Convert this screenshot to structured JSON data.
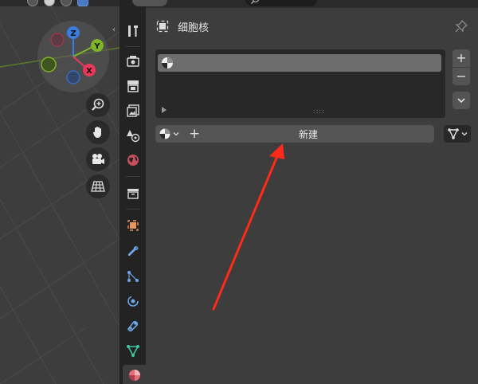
{
  "properties": {
    "breadcrumb_label": "细胞核",
    "new_button_label": "新建",
    "add_symbol": "+",
    "remove_symbol": "−",
    "list_grip": "::::"
  },
  "viewport": {
    "axis_labels": {
      "z": "Z",
      "y": "Y",
      "x": "X"
    }
  },
  "colors": {
    "axis_x": "#e8395a",
    "axis_y": "#7fb524",
    "axis_z": "#3a7de0",
    "annotation_arrow": "#ff2a1a",
    "active_tab_material": "#e66c78"
  },
  "icons": {
    "tabs": [
      "tool-icon",
      "render-icon",
      "output-icon",
      "view-layer-icon",
      "scene-icon",
      "world-icon",
      "collection-icon",
      "object-icon",
      "modifier-icon",
      "particles-icon",
      "physics-icon",
      "constraints-icon",
      "data-icon",
      "material-icon"
    ],
    "viewport_nav": [
      "zoom-icon",
      "hand-icon",
      "camera-icon",
      "grid-icon"
    ]
  }
}
